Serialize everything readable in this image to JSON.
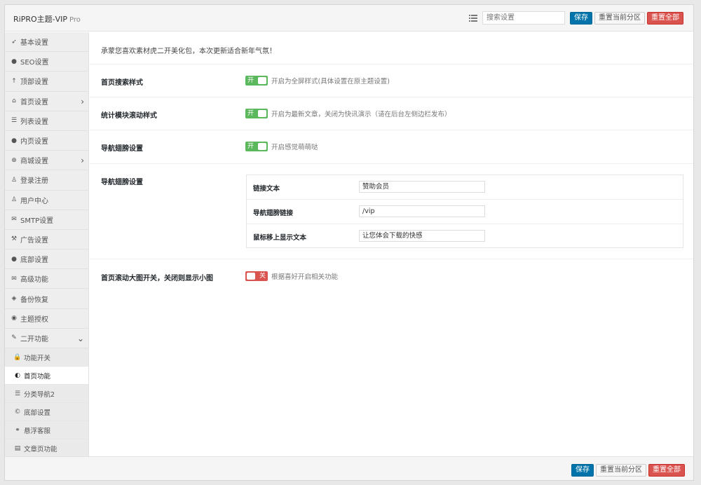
{
  "header": {
    "brand": "RiPRO主题-VIP",
    "brand_suffix": "Pro",
    "search_placeholder": "搜索设置",
    "save": "保存",
    "reset_section": "重置当前分区",
    "reset_all": "重置全部"
  },
  "sidebar": {
    "items": [
      {
        "icon": "rocket-icon",
        "glyph": "➶",
        "label": "基本设置"
      },
      {
        "icon": "circle-icon",
        "glyph": "●",
        "label": "SEO设置"
      },
      {
        "icon": "arrow-up-icon",
        "glyph": "↑",
        "label": "顶部设置"
      },
      {
        "icon": "home-icon",
        "glyph": "⌂",
        "label": "首页设置",
        "chevron": "›"
      },
      {
        "icon": "list-icon",
        "glyph": "☰",
        "label": "列表设置"
      },
      {
        "icon": "circle-icon",
        "glyph": "●",
        "label": "内页设置"
      },
      {
        "icon": "plus-circle-icon",
        "glyph": "⊕",
        "label": "商城设置",
        "chevron": "›"
      },
      {
        "icon": "user-icon",
        "glyph": "♙",
        "label": "登录注册"
      },
      {
        "icon": "user-icon",
        "glyph": "♙",
        "label": "用户中心"
      },
      {
        "icon": "envelope-icon",
        "glyph": "✉",
        "label": "SMTP设置"
      },
      {
        "icon": "gavel-icon",
        "glyph": "⚒",
        "label": "广告设置"
      },
      {
        "icon": "circle-icon",
        "glyph": "●",
        "label": "底部设置"
      },
      {
        "icon": "envelope-icon",
        "glyph": "✉",
        "label": "高级功能"
      },
      {
        "icon": "shield-icon",
        "glyph": "◈",
        "label": "备份恢复"
      },
      {
        "icon": "eye-icon",
        "glyph": "◉",
        "label": "主题授权"
      },
      {
        "icon": "wrench-icon",
        "glyph": "✎",
        "label": "二开功能",
        "chevron": "⌄"
      }
    ],
    "sub_items": [
      {
        "icon": "lock-icon",
        "glyph": "🔒",
        "label": "功能开关",
        "active": false
      },
      {
        "icon": "dashboard-icon",
        "glyph": "◐",
        "label": "首页功能",
        "active": true
      },
      {
        "icon": "list-icon",
        "glyph": "☰",
        "label": "分类导航2",
        "active": false
      },
      {
        "icon": "copyright-icon",
        "glyph": "©",
        "label": "底部设置",
        "active": false
      },
      {
        "icon": "link-icon",
        "glyph": "⚭",
        "label": "悬浮客服",
        "active": false
      },
      {
        "icon": "book-icon",
        "glyph": "▤",
        "label": "文章页功能",
        "active": false
      }
    ]
  },
  "content": {
    "intro": "承蒙您喜欢素材虎二开美化包，本次更新适合新年气氛！",
    "rows": [
      {
        "label": "首页搜索样式",
        "state": "开",
        "hint": "开启为全屏样式(具体设置在原主题设置)"
      },
      {
        "label": "统计模块滚动样式",
        "state": "开",
        "hint": "开启为最新文章，关闭为快讯演示（请在后台左侧边栏发布）"
      },
      {
        "label": "导航翅膀设置",
        "state": "开",
        "hint": "开启感觉萌萌哒"
      }
    ],
    "group": {
      "label": "导航翅膀设置",
      "fields": [
        {
          "label": "链接文本",
          "value": "赞助会员"
        },
        {
          "label": "导航翅膀链接",
          "value": "/vip"
        },
        {
          "label": "鼠标移上显示文本",
          "value": "让您体会下载的快感"
        }
      ]
    },
    "last_row": {
      "label": "首页滚动大图开关，关闭则显示小图",
      "state": "关",
      "hint": "根据喜好开启相关功能"
    }
  },
  "colors": {
    "save": "#0073aa",
    "reset_all": "#d9534f",
    "toggle_on": "#5cb85c",
    "toggle_off": "#d9534f"
  }
}
